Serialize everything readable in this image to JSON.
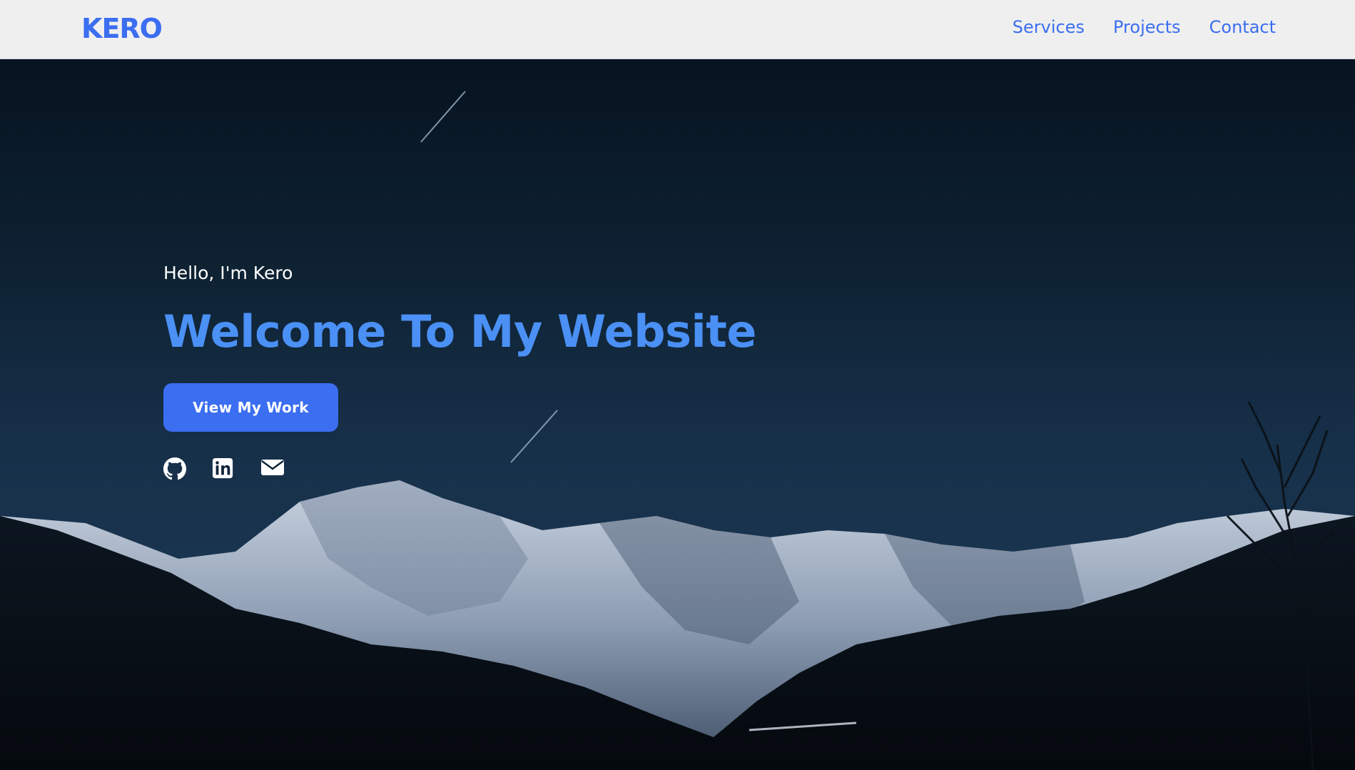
{
  "navbar": {
    "brand": "KERO",
    "links": [
      {
        "label": "Services"
      },
      {
        "label": "Projects"
      },
      {
        "label": "Contact"
      }
    ]
  },
  "hero": {
    "greeting": "Hello, I'm Kero",
    "headline": "Welcome To My Website",
    "cta_label": "View My Work",
    "socials": [
      {
        "icon": "github-icon"
      },
      {
        "icon": "linkedin-icon"
      },
      {
        "icon": "email-icon"
      }
    ]
  },
  "colors": {
    "accent": "#3b6ef0",
    "headline": "#4a90f5",
    "nav_bg": "#efefef"
  }
}
